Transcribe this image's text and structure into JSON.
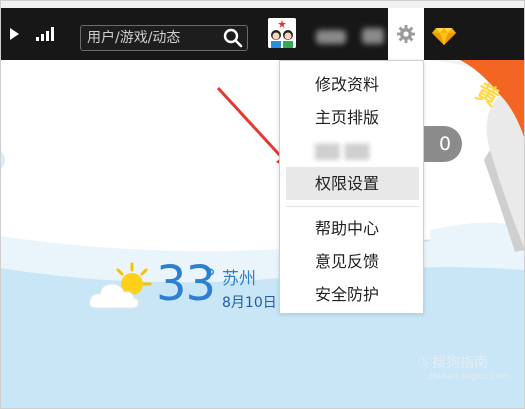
{
  "topbar": {
    "search": {
      "placeholder": "用户/游戏/动态"
    }
  },
  "menu": {
    "items": [
      {
        "label": "修改资料",
        "active": false
      },
      {
        "label": "主页排版",
        "active": false
      },
      {
        "label": "",
        "active": false
      },
      {
        "label": "权限设置",
        "active": true
      },
      {
        "label": "帮助中心",
        "active": false
      },
      {
        "label": "意见反馈",
        "active": false
      },
      {
        "label": "安全防护",
        "active": false
      }
    ]
  },
  "badge": {
    "count": "0"
  },
  "banner": {
    "text": "黄"
  },
  "weather": {
    "temperature": "33",
    "degree_symbol": "°",
    "city": "苏州",
    "date": "8月10日"
  },
  "watermark": {
    "text": "Ⓢ搜狗指南",
    "url": "zhinan.sogou.com"
  },
  "colors": {
    "topbar": "#171717",
    "background": "#c9e6f6",
    "accent_blue": "#2e7fd2",
    "arrow_red": "#e23a30",
    "banner_orange": "#f26522"
  },
  "icons": [
    "play-icon",
    "signal-icon",
    "search-icon",
    "avatar",
    "gear-icon",
    "diamond-icon",
    "weather-cloud-sun-icon"
  ]
}
